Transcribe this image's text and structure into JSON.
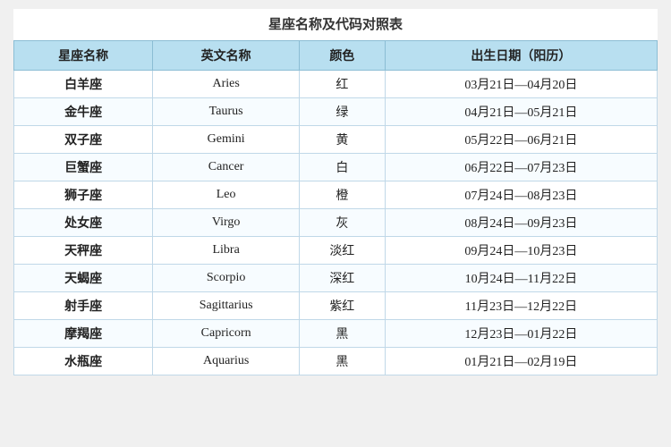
{
  "title": "星座名称及代码对照表",
  "headers": [
    "星座名称",
    "英文名称",
    "颜色",
    "出生日期（阳历）"
  ],
  "rows": [
    {
      "zh": "白羊座",
      "en": "Aries",
      "color": "红",
      "dates": "03月21日—04月20日"
    },
    {
      "zh": "金牛座",
      "en": "Taurus",
      "color": "绿",
      "dates": "04月21日—05月21日"
    },
    {
      "zh": "双子座",
      "en": "Gemini",
      "color": "黄",
      "dates": "05月22日—06月21日"
    },
    {
      "zh": "巨蟹座",
      "en": "Cancer",
      "color": "白",
      "dates": "06月22日—07月23日"
    },
    {
      "zh": "狮子座",
      "en": "Leo",
      "color": "橙",
      "dates": "07月24日—08月23日"
    },
    {
      "zh": "处女座",
      "en": "Virgo",
      "color": "灰",
      "dates": "08月24日—09月23日"
    },
    {
      "zh": "天秤座",
      "en": "Libra",
      "color": "淡红",
      "dates": "09月24日—10月23日"
    },
    {
      "zh": "天蝎座",
      "en": "Scorpio",
      "color": "深红",
      "dates": "10月24日—11月22日"
    },
    {
      "zh": "射手座",
      "en": "Sagittarius",
      "color": "紫红",
      "dates": "11月23日—12月22日"
    },
    {
      "zh": "摩羯座",
      "en": "Capricorn",
      "color": "黑",
      "dates": "12月23日—01月22日"
    },
    {
      "zh": "水瓶座",
      "en": "Aquarius",
      "color": "黑",
      "dates": "01月21日—02月19日"
    }
  ]
}
